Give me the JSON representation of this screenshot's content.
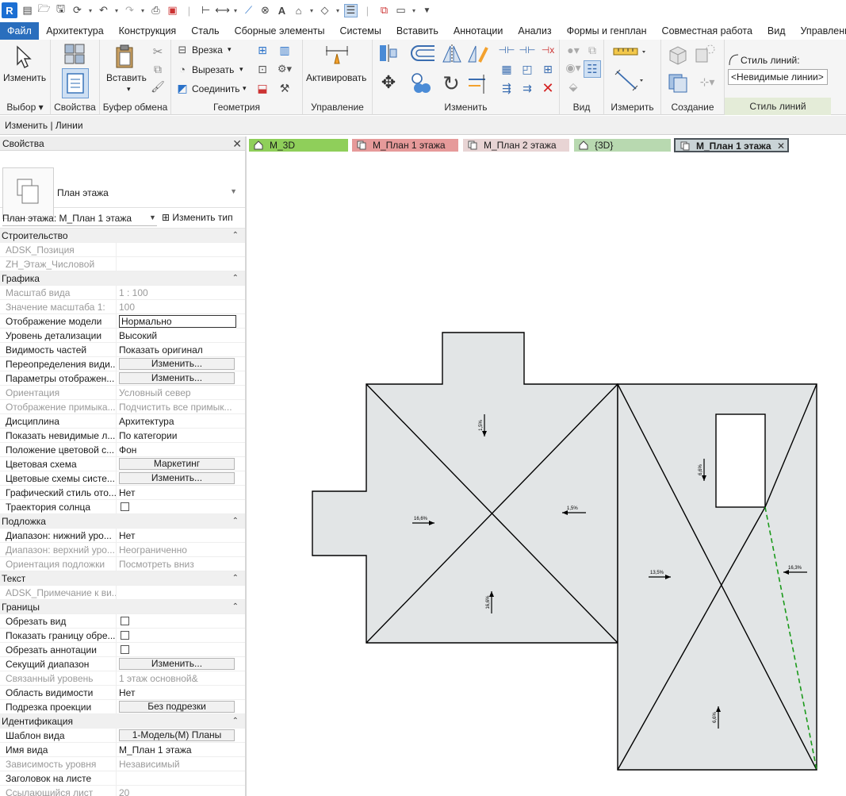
{
  "app": {
    "logo": "R"
  },
  "qat_icons": [
    "file-icon",
    "open-icon",
    "save-icon",
    "sync-icon",
    "undo-icon",
    "redo-icon",
    "print-icon",
    "export-icon",
    "measure-icon",
    "dimension-icon",
    "tag-icon",
    "text-icon",
    "home-3d-icon",
    "section-icon",
    "thin-lines-icon",
    "close-hidden-icon",
    "switch-windows-icon",
    "customize-icon"
  ],
  "menu": {
    "items": [
      "Файл",
      "Архитектура",
      "Конструкция",
      "Сталь",
      "Сборные элементы",
      "Системы",
      "Вставить",
      "Аннотации",
      "Анализ",
      "Формы и генплан",
      "Совместная работа",
      "Вид",
      "Управление"
    ]
  },
  "ribbon": {
    "select": {
      "button": "Изменить",
      "label": "Выбор"
    },
    "properties": {
      "label": "Свойства"
    },
    "clipboard": {
      "button": "Вставить",
      "label": "Буфер обмена"
    },
    "geometry": {
      "cut": "Врезка",
      "cut_out": "Вырезать",
      "join": "Соединить",
      "label": "Геометрия"
    },
    "control": {
      "button": "Активировать",
      "label": "Управление"
    },
    "modify": {
      "label": "Изменить"
    },
    "view": {
      "label": "Вид"
    },
    "measure": {
      "label": "Измерить"
    },
    "create": {
      "label": "Создание"
    },
    "line_style": {
      "title": "Стиль линий:",
      "value": "<Невидимые линии>",
      "label": "Стиль линий"
    }
  },
  "context_bar": {
    "text": "Изменить | Линии"
  },
  "properties": {
    "title": "Свойства",
    "type_name": "План этажа",
    "view_selector": "План этажа: М_План 1 этажа",
    "edit_type": "Изменить тип",
    "rows": [
      {
        "kind": "group",
        "label": "Строительство"
      },
      {
        "kind": "row",
        "key": "ADSK_Позиция",
        "value": "",
        "dim": true
      },
      {
        "kind": "row",
        "key": "ZH_Этаж_Числовой",
        "value": "",
        "dim": true
      },
      {
        "kind": "group",
        "label": "Графика"
      },
      {
        "kind": "row",
        "key": "Масштаб вида",
        "value": "1 : 100",
        "dim": true
      },
      {
        "kind": "row",
        "key": "Значение масштаба    1:",
        "value": "100",
        "dim": true
      },
      {
        "kind": "row",
        "key": "Отображение модели",
        "value": "Нормально",
        "box": true
      },
      {
        "kind": "row",
        "key": "Уровень детализации",
        "value": "Высокий"
      },
      {
        "kind": "row",
        "key": "Видимость частей",
        "value": "Показать оригинал"
      },
      {
        "kind": "row",
        "key": "Переопределения види...",
        "value": "Изменить...",
        "button": true
      },
      {
        "kind": "row",
        "key": "Параметры отображен...",
        "value": "Изменить...",
        "button": true
      },
      {
        "kind": "row",
        "key": "Ориентация",
        "value": "Условный север",
        "dim": true
      },
      {
        "kind": "row",
        "key": "Отображение примыка...",
        "value": "Подчистить все примык...",
        "dim": true
      },
      {
        "kind": "row",
        "key": "Дисциплина",
        "value": "Архитектура"
      },
      {
        "kind": "row",
        "key": "Показать невидимые л...",
        "value": "По категории"
      },
      {
        "kind": "row",
        "key": "Положение цветовой с...",
        "value": "Фон"
      },
      {
        "kind": "row",
        "key": "Цветовая схема",
        "value": "Маркетинг",
        "button": true
      },
      {
        "kind": "row",
        "key": "Цветовые схемы систе...",
        "value": "Изменить...",
        "button": true
      },
      {
        "kind": "row",
        "key": "Графический стиль ото...",
        "value": "Нет"
      },
      {
        "kind": "row",
        "key": "Траектория солнца",
        "value": "",
        "checkbox": true
      },
      {
        "kind": "group",
        "label": "Подложка"
      },
      {
        "kind": "row",
        "key": "Диапазон: нижний уро...",
        "value": "Нет"
      },
      {
        "kind": "row",
        "key": "Диапазон: верхний уро...",
        "value": "Неограниченно",
        "dim": true
      },
      {
        "kind": "row",
        "key": "Ориентация подложки",
        "value": "Посмотреть вниз",
        "dim": true
      },
      {
        "kind": "group",
        "label": "Текст"
      },
      {
        "kind": "row",
        "key": "ADSK_Примечание к ви...",
        "value": "",
        "dim": true
      },
      {
        "kind": "group",
        "label": "Границы"
      },
      {
        "kind": "row",
        "key": "Обрезать вид",
        "value": "",
        "checkbox": true
      },
      {
        "kind": "row",
        "key": "Показать границу обре...",
        "value": "",
        "checkbox": true
      },
      {
        "kind": "row",
        "key": "Обрезать аннотации",
        "value": "",
        "checkbox": true
      },
      {
        "kind": "row",
        "key": "Секущий диапазон",
        "value": "Изменить...",
        "button": true
      },
      {
        "kind": "row",
        "key": "Связанный уровень",
        "value": "1 этаж основной&",
        "dim": true
      },
      {
        "kind": "row",
        "key": "Область видимости",
        "value": "Нет"
      },
      {
        "kind": "row",
        "key": "Подрезка проекции",
        "value": "Без подрезки",
        "button": true
      },
      {
        "kind": "group",
        "label": "Идентификация"
      },
      {
        "kind": "row",
        "key": "Шаблон вида",
        "value": "1-Модель(М) Планы",
        "button": true
      },
      {
        "kind": "row",
        "key": "Имя вида",
        "value": "М_План 1 этажа"
      },
      {
        "kind": "row",
        "key": "Зависимость уровня",
        "value": "Независимый",
        "dim": true
      },
      {
        "kind": "row",
        "key": "Заголовок на листе",
        "value": ""
      },
      {
        "kind": "row",
        "key": "Ссылающийся лист",
        "value": "20",
        "dim": true
      }
    ]
  },
  "tabs": [
    {
      "label": "М_3D",
      "color": "#8fcf5a",
      "icon": "house-icon",
      "active": false
    },
    {
      "label": "М_План 1 этажа",
      "color": "#e69a9a",
      "icon": "plan-icon",
      "active": false
    },
    {
      "label": "М_План 2 этажа",
      "color": "#e8d4d4",
      "icon": "plan-icon",
      "active": false
    },
    {
      "label": "{3D}",
      "color": "#b8d9b0",
      "icon": "house-icon",
      "active": false
    },
    {
      "label": "М_План 1 этажа",
      "color": "#c9d3d6",
      "icon": "plan-icon",
      "active": true
    }
  ],
  "drawing": {
    "fill": "#e2e5e6",
    "slope_labels": [
      "1,5%",
      "16,6%",
      "1,5%",
      "16,6%",
      "6,6%",
      "13,5%",
      "16,3%",
      "6,6%"
    ]
  }
}
